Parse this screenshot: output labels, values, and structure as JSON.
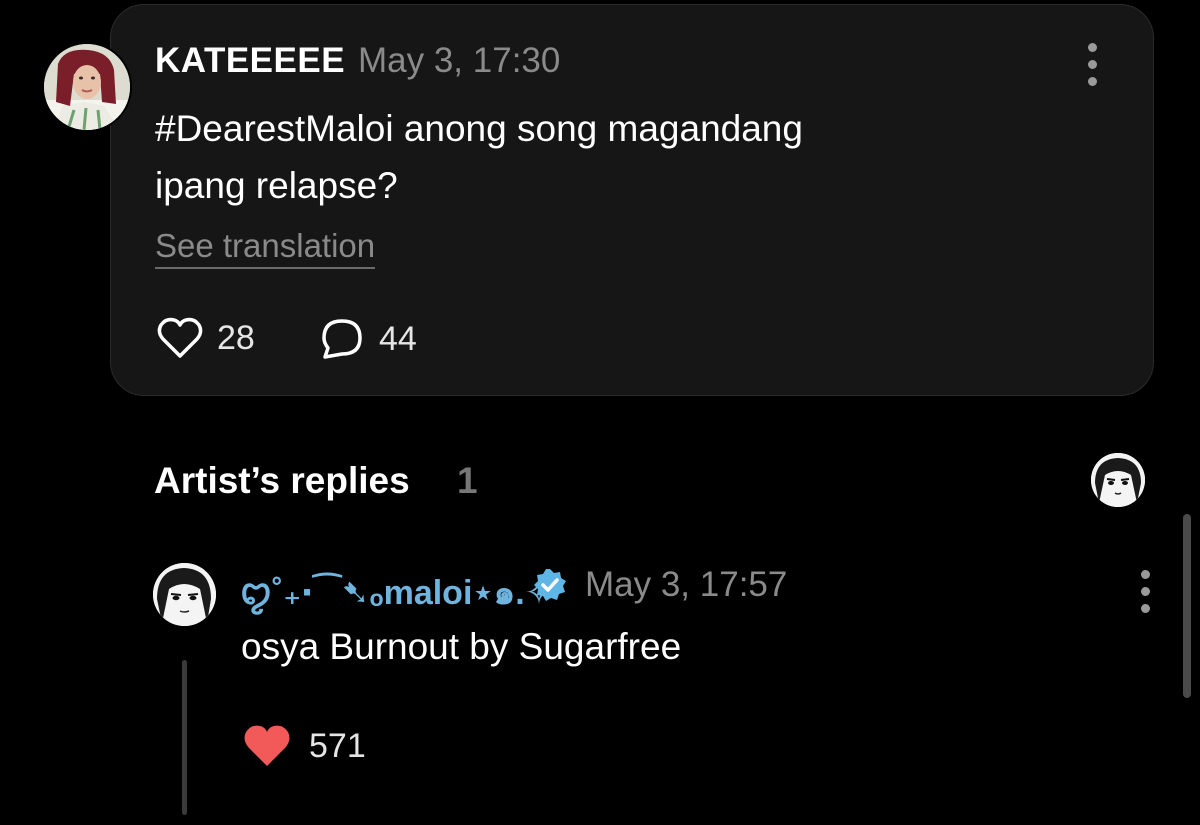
{
  "post": {
    "author": "KATEEEEE",
    "timestamp": "May 3, 17:30",
    "text_line1": "#DearestMaloi anong song magandang",
    "text_line2": "ipang relapse?",
    "see_translation": "See translation",
    "likes": "28",
    "comments": "44"
  },
  "artist_replies": {
    "title": "Artist’s replies",
    "count": "1"
  },
  "reply": {
    "author": "ꨄ˚₊‧⁀➷ₒmaloi⋆๑.✧˚",
    "timestamp": "May 3, 17:57",
    "text": "osya Burnout by Sugarfree",
    "likes": "571"
  },
  "colors": {
    "background": "#000000",
    "card": "#161616",
    "muted_text": "#8a8a8a",
    "reply_author": "#6fb4df",
    "liked_heart": "#f25a5a",
    "verified_badge": "#5fb6e6"
  },
  "icons": {
    "like": "heart-outline-icon",
    "comment": "speech-bubble-icon",
    "more": "more-vertical-icon",
    "verified": "verified-badge-icon",
    "liked": "heart-filled-icon"
  }
}
